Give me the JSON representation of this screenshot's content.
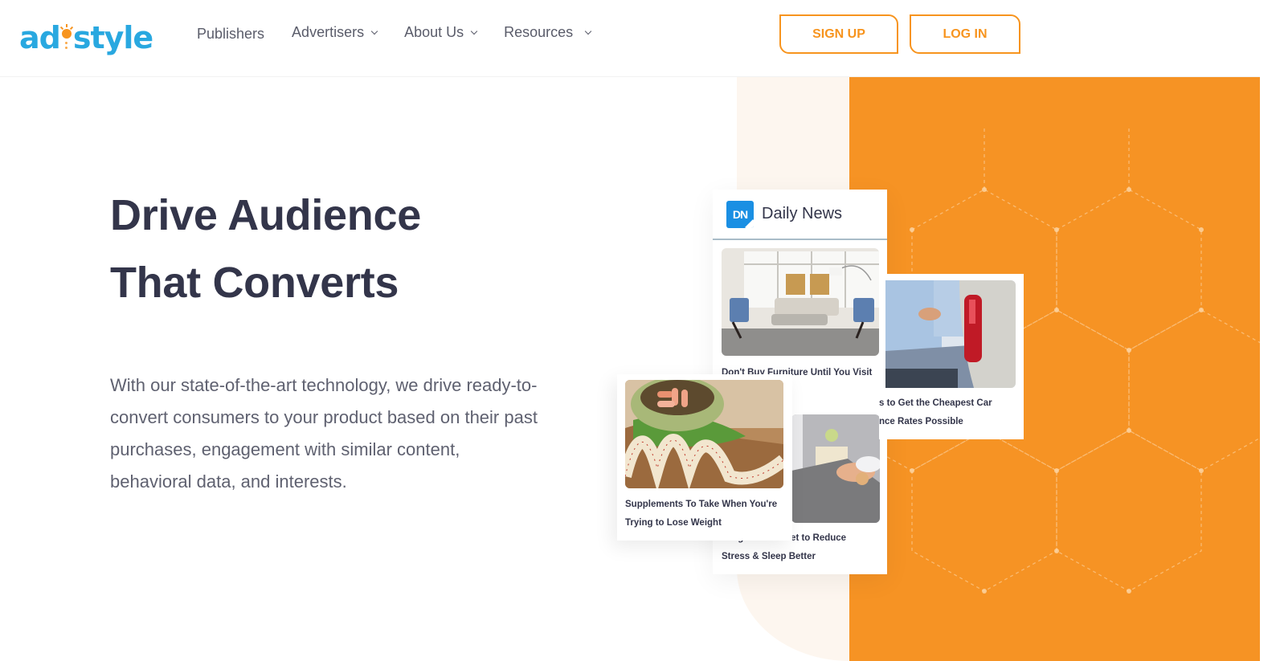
{
  "brand": {
    "logo_left": "ad",
    "logo_right": "style",
    "primary_color": "#29a8e0",
    "accent_color": "#f7941e"
  },
  "nav": {
    "items": [
      {
        "label": "Publishers",
        "has_dropdown": false
      },
      {
        "label": "Advertisers",
        "has_dropdown": true
      },
      {
        "label": "About Us",
        "has_dropdown": true
      },
      {
        "label": "Resources",
        "has_dropdown": true
      }
    ],
    "signup_label": "SIGN UP",
    "login_label": "LOG IN"
  },
  "hero": {
    "title_line1": "Drive Audience",
    "title_line2": "That Converts",
    "description": "With our state-of-the-art technology, we drive ready-to-convert consumers to your product based on their past purchases, engagement with similar content, behavioral data, and interests."
  },
  "widget": {
    "publisher_logo": "DN",
    "publisher_name": "Daily News",
    "articles": [
      {
        "title": "Don't Buy Furniture Until You Visit",
        "image": "living-room"
      },
      {
        "title_line1": "s to Get the Cheapest Car",
        "title_line2": "nce Rates Possible",
        "image": "car-handshake"
      },
      {
        "title_line1": "Supplements To Take When You're",
        "title_line2": "Trying to Lose Weight",
        "image": "supplements-tape"
      },
      {
        "title_line1": "Weighted Blanket to Reduce",
        "title_line2": "Stress & Sleep Better",
        "image": "weighted-blanket"
      }
    ]
  }
}
